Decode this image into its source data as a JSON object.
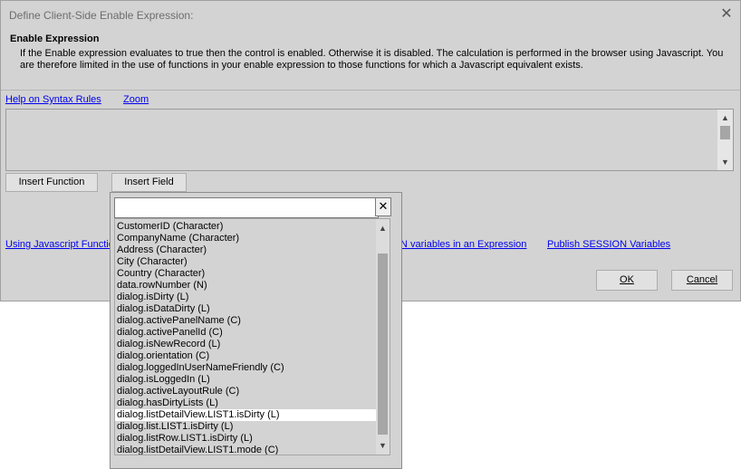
{
  "window": {
    "title": "Define Client-Side Enable Expression:",
    "close_glyph": "✕"
  },
  "header": {
    "title": "Enable Expression",
    "description": "If the Enable expression evaluates to true then the control is enabled. Otherwise it is disabled. The calculation is performed in the browser using Javascript. You are therefore limited in the use of functions in your enable expression to those functions for which a Javascript equivalent exists."
  },
  "links": {
    "help_syntax": "Help on Syntax Rules",
    "zoom": "Zoom",
    "using_js_functions": "Using Javascript Functio",
    "session_vars_expr": "N variables in an Expression",
    "publish_session": "Publish SESSION Variables"
  },
  "expression": {
    "value": ""
  },
  "buttons": {
    "insert_function": "Insert Function",
    "insert_field": "Insert Field",
    "ok": "OK",
    "cancel": "Cancel"
  },
  "field_picker": {
    "search_value": "",
    "clear_glyph": "✕",
    "items": [
      "CustomerID (Character)",
      "CompanyName (Character)",
      "Address (Character)",
      "City (Character)",
      "Country (Character)",
      "data.rowNumber (N)",
      "dialog.isDirty (L)",
      "dialog.isDataDirty (L)",
      "dialog.activePanelName (C)",
      "dialog.activePanelId (C)",
      "dialog.isNewRecord (L)",
      "dialog.orientation (C)",
      "dialog.loggedInUserNameFriendly (C)",
      "dialog.isLoggedIn (L)",
      "dialog.activeLayoutRule (C)",
      "dialog.hasDirtyLists (L)",
      "dialog.listDetailView.LIST1.isDirty (L)",
      "dialog.list.LIST1.isDirty (L)",
      "dialog.listRow.LIST1.isDirty (L)",
      "dialog.listDetailView.LIST1.mode (C)"
    ],
    "selected_index": 16
  },
  "icons": {
    "scroll_up": "▲",
    "scroll_down": "▼"
  }
}
